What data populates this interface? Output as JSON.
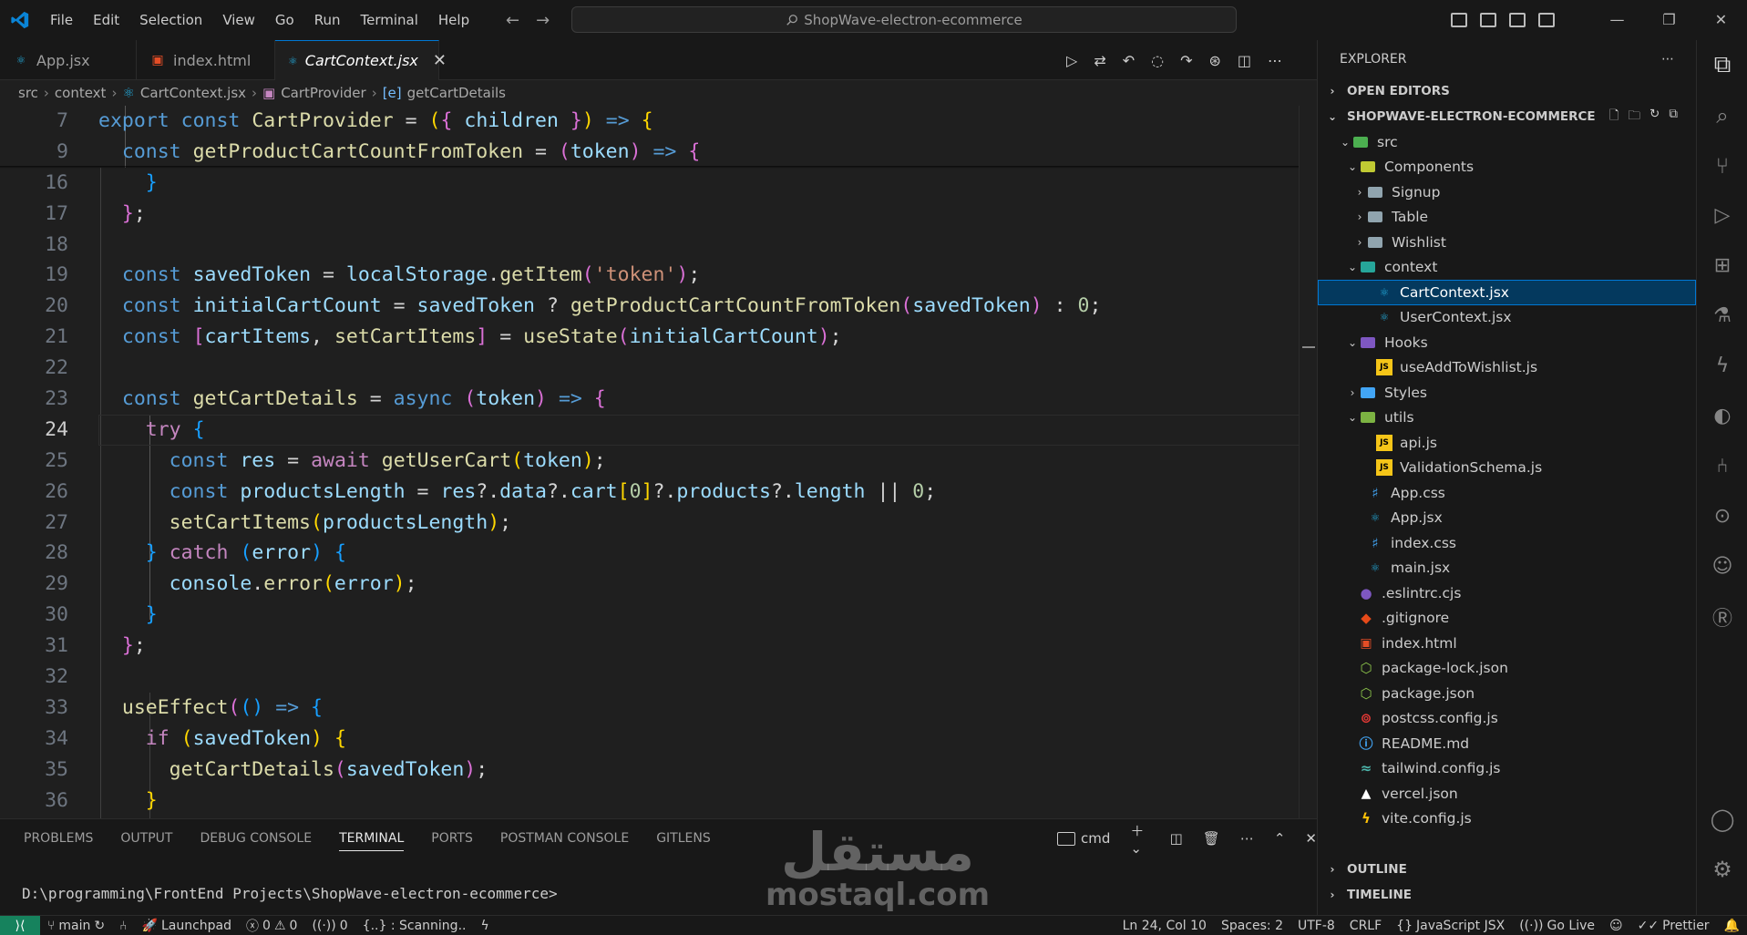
{
  "menu": [
    "File",
    "Edit",
    "Selection",
    "View",
    "Go",
    "Run",
    "Terminal",
    "Help"
  ],
  "search_text": "ShopWave-electron-ecommerce",
  "tabs": [
    {
      "label": "App.jsx"
    },
    {
      "label": "index.html"
    },
    {
      "label": "CartContext.jsx"
    }
  ],
  "breadcrumb": [
    "src",
    "context",
    "CartContext.jsx",
    "CartProvider",
    "getCartDetails"
  ],
  "line_numbers": [
    "7",
    "9",
    "16",
    "17",
    "18",
    "19",
    "20",
    "21",
    "22",
    "23",
    "24",
    "25",
    "26",
    "27",
    "28",
    "29",
    "30",
    "31",
    "32",
    "33",
    "34",
    "35",
    "36"
  ],
  "panel": {
    "tabs": [
      "PROBLEMS",
      "OUTPUT",
      "DEBUG CONSOLE",
      "TERMINAL",
      "PORTS",
      "POSTMAN CONSOLE",
      "GITLENS"
    ],
    "shell": "cmd",
    "terminal_line": "D:\\programming\\FrontEnd Projects\\ShopWave-electron-ecommerce>"
  },
  "watermark": {
    "arabic": "مستقل",
    "latin": "mostaql.com"
  },
  "explorer": {
    "title": "EXPLORER",
    "open_editors": "OPEN EDITORS",
    "project": "SHOPWAVE-ELECTRON-ECOMMERCE",
    "outline": "OUTLINE",
    "timeline": "TIMELINE",
    "tree": [
      {
        "name": "src"
      },
      {
        "name": "Components"
      },
      {
        "name": "Signup"
      },
      {
        "name": "Table"
      },
      {
        "name": "Wishlist"
      },
      {
        "name": "context"
      },
      {
        "name": "CartContext.jsx"
      },
      {
        "name": "UserContext.jsx"
      },
      {
        "name": "Hooks"
      },
      {
        "name": "useAddToWishlist.js"
      },
      {
        "name": "Styles"
      },
      {
        "name": "utils"
      },
      {
        "name": "api.js"
      },
      {
        "name": "ValidationSchema.js"
      },
      {
        "name": "App.css"
      },
      {
        "name": "App.jsx"
      },
      {
        "name": "index.css"
      },
      {
        "name": "main.jsx"
      },
      {
        "name": ".eslintrc.cjs"
      },
      {
        "name": ".gitignore"
      },
      {
        "name": "index.html"
      },
      {
        "name": "package-lock.json"
      },
      {
        "name": "package.json"
      },
      {
        "name": "postcss.config.js"
      },
      {
        "name": "README.md"
      },
      {
        "name": "tailwind.config.js"
      },
      {
        "name": "vercel.json"
      },
      {
        "name": "vite.config.js"
      }
    ]
  },
  "status": {
    "branch": "main",
    "launchpad": "Launchpad",
    "errors": "0",
    "warnings": "0",
    "ports": "0",
    "scanning": "{..} : Scanning..",
    "position": "Ln 24, Col 10",
    "spaces": "Spaces: 2",
    "encoding": "UTF-8",
    "eol": "CRLF",
    "language": "JavaScript JSX",
    "golive": "Go Live",
    "prettier": "Prettier"
  },
  "colors": {
    "accent": "#0078d4",
    "selection": "#04395e",
    "remote": "#16825d",
    "keyword": "#569cd6",
    "function": "#dcdcaa",
    "variable": "#9cdcfe",
    "string": "#ce9178"
  }
}
